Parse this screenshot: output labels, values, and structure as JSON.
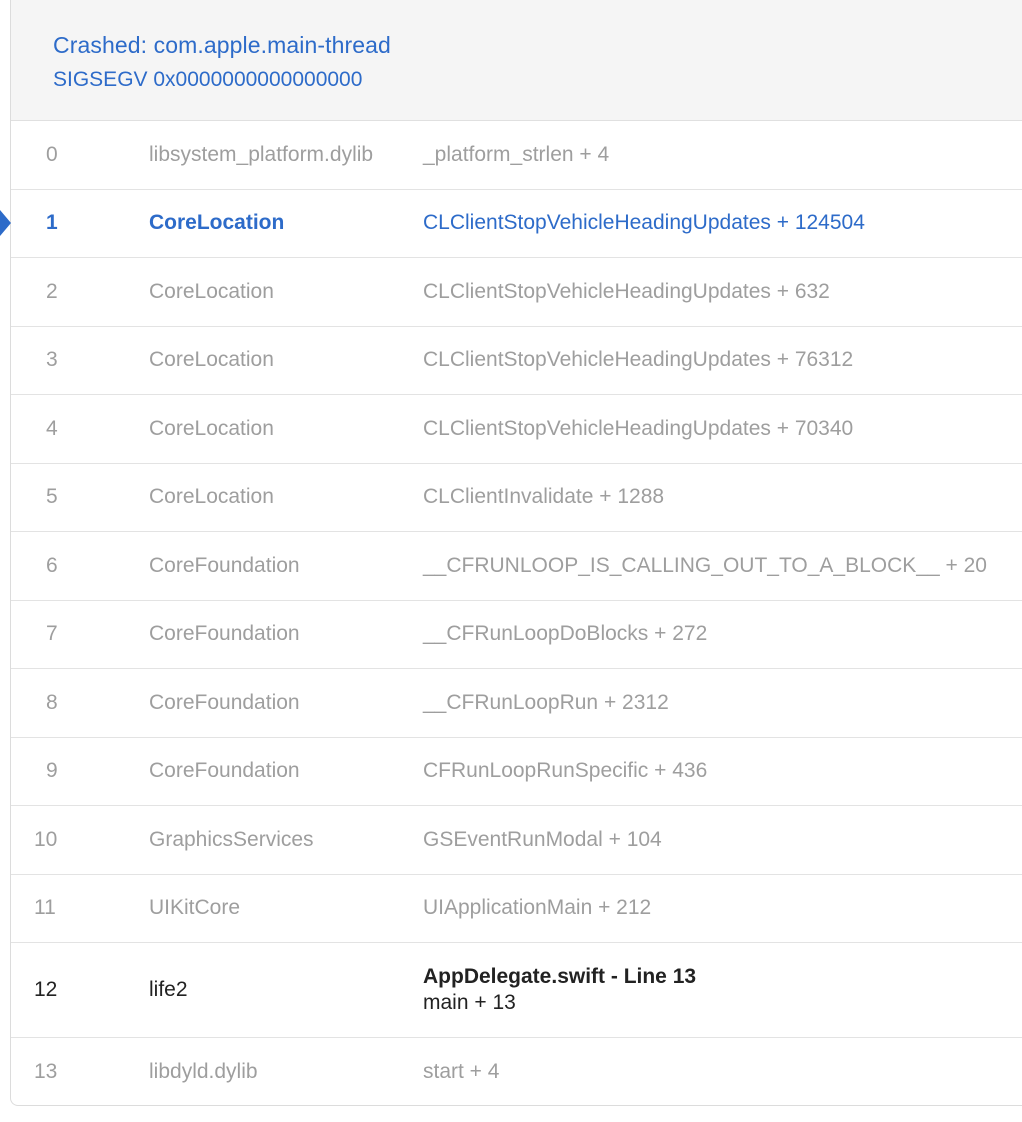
{
  "header": {
    "title": "Crashed: com.apple.main-thread",
    "signal": "SIGSEGV 0x0000000000000000"
  },
  "frames": [
    {
      "index": "0",
      "library": "libsystem_platform.dylib",
      "symbol": "_platform_strlen + 4"
    },
    {
      "index": "1",
      "library": "CoreLocation",
      "symbol": "CLClientStopVehicleHeadingUpdates + 124504"
    },
    {
      "index": "2",
      "library": "CoreLocation",
      "symbol": "CLClientStopVehicleHeadingUpdates + 632"
    },
    {
      "index": "3",
      "library": "CoreLocation",
      "symbol": "CLClientStopVehicleHeadingUpdates + 76312"
    },
    {
      "index": "4",
      "library": "CoreLocation",
      "symbol": "CLClientStopVehicleHeadingUpdates + 70340"
    },
    {
      "index": "5",
      "library": "CoreLocation",
      "symbol": "CLClientInvalidate + 1288"
    },
    {
      "index": "6",
      "library": "CoreFoundation",
      "symbol": "__CFRUNLOOP_IS_CALLING_OUT_TO_A_BLOCK__ + 20"
    },
    {
      "index": "7",
      "library": "CoreFoundation",
      "symbol": "__CFRunLoopDoBlocks + 272"
    },
    {
      "index": "8",
      "library": "CoreFoundation",
      "symbol": "__CFRunLoopRun + 2312"
    },
    {
      "index": "9",
      "library": "CoreFoundation",
      "symbol": "CFRunLoopRunSpecific + 436"
    },
    {
      "index": "10",
      "library": "GraphicsServices",
      "symbol": "GSEventRunModal + 104"
    },
    {
      "index": "11",
      "library": "UIKitCore",
      "symbol": "UIApplicationMain + 212"
    },
    {
      "index": "12",
      "library": "life2",
      "symbol_file": "AppDelegate.swift - Line 13",
      "symbol": "main + 13"
    },
    {
      "index": "13",
      "library": "libdyld.dylib",
      "symbol": "start + 4"
    }
  ],
  "colors": {
    "accent": "#2d6bc9",
    "muted": "#9e9e9e",
    "own_code": "#222222"
  },
  "icons": {
    "selected_marker": "triangle-right-icon"
  }
}
